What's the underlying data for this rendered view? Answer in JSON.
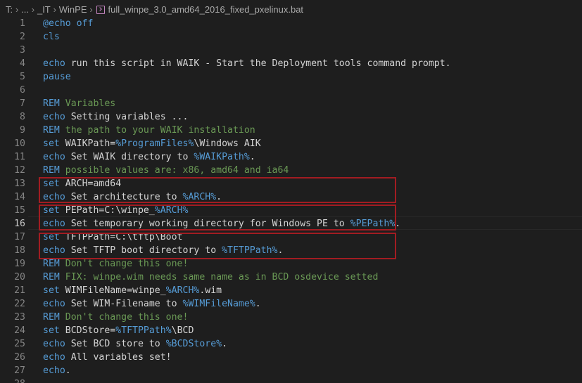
{
  "breadcrumb": {
    "items": [
      "T:",
      "...",
      "_IT",
      "WinPE"
    ],
    "file_icon": "batch-file-icon",
    "file_name": "full_winpe_3.0_amd64_2016_fixed_pxelinux.bat"
  },
  "colors": {
    "background": "#1e1e1e",
    "keyword": "#569cd6",
    "comment": "#6a9955",
    "text": "#d4d4d4",
    "line_number": "#858585",
    "highlight_box": "#a21c22"
  },
  "editor": {
    "active_line": 16,
    "highlighted_ranges": [
      [
        13,
        14
      ],
      [
        15,
        16
      ],
      [
        17,
        18
      ]
    ],
    "lines": [
      {
        "n": "1",
        "tokens": [
          {
            "t": "kw",
            "v": "@echo off"
          }
        ]
      },
      {
        "n": "2",
        "tokens": [
          {
            "t": "kw",
            "v": "cls"
          }
        ]
      },
      {
        "n": "3",
        "tokens": []
      },
      {
        "n": "4",
        "tokens": [
          {
            "t": "kw",
            "v": "echo"
          },
          {
            "t": "txt",
            "v": " run this script in WAIK - Start the Deployment tools command prompt."
          }
        ]
      },
      {
        "n": "5",
        "tokens": [
          {
            "t": "kw",
            "v": "pause"
          }
        ]
      },
      {
        "n": "6",
        "tokens": []
      },
      {
        "n": "7",
        "tokens": [
          {
            "t": "kw",
            "v": "REM"
          },
          {
            "t": "cmt",
            "v": " Variables"
          }
        ]
      },
      {
        "n": "8",
        "tokens": [
          {
            "t": "kw",
            "v": "echo"
          },
          {
            "t": "txt",
            "v": " Setting variables ..."
          }
        ]
      },
      {
        "n": "9",
        "tokens": [
          {
            "t": "kw",
            "v": "REM"
          },
          {
            "t": "cmt",
            "v": " the path to your WAIK installation"
          }
        ]
      },
      {
        "n": "10",
        "tokens": [
          {
            "t": "kw",
            "v": "set"
          },
          {
            "t": "txt",
            "v": " WAIKPath="
          },
          {
            "t": "var",
            "v": "%ProgramFiles%"
          },
          {
            "t": "txt",
            "v": "\\Windows AIK"
          }
        ]
      },
      {
        "n": "11",
        "tokens": [
          {
            "t": "kw",
            "v": "echo"
          },
          {
            "t": "txt",
            "v": " Set WAIK directory to "
          },
          {
            "t": "var",
            "v": "%WAIKPath%"
          },
          {
            "t": "txt",
            "v": "."
          }
        ]
      },
      {
        "n": "12",
        "tokens": [
          {
            "t": "kw",
            "v": "REM"
          },
          {
            "t": "cmt",
            "v": " possible values are: x86, amd64 and ia64"
          }
        ]
      },
      {
        "n": "13",
        "tokens": [
          {
            "t": "kw",
            "v": "set"
          },
          {
            "t": "txt",
            "v": " ARCH=amd64"
          }
        ]
      },
      {
        "n": "14",
        "tokens": [
          {
            "t": "kw",
            "v": "echo"
          },
          {
            "t": "txt",
            "v": " Set architecture to "
          },
          {
            "t": "var",
            "v": "%ARCH%"
          },
          {
            "t": "txt",
            "v": "."
          }
        ]
      },
      {
        "n": "15",
        "tokens": [
          {
            "t": "kw",
            "v": "set"
          },
          {
            "t": "txt",
            "v": " PEPath=C:\\winpe_"
          },
          {
            "t": "var",
            "v": "%ARCH%"
          }
        ]
      },
      {
        "n": "16",
        "tokens": [
          {
            "t": "kw",
            "v": "echo"
          },
          {
            "t": "txt",
            "v": " Set temporary working directory for Windows PE to "
          },
          {
            "t": "var",
            "v": "%PEPath%"
          },
          {
            "t": "txt",
            "v": "."
          }
        ]
      },
      {
        "n": "17",
        "tokens": [
          {
            "t": "kw",
            "v": "set"
          },
          {
            "t": "txt",
            "v": " TFTPPath=C:\\tftp\\Boot"
          }
        ]
      },
      {
        "n": "18",
        "tokens": [
          {
            "t": "kw",
            "v": "echo"
          },
          {
            "t": "txt",
            "v": " Set TFTP boot directory to "
          },
          {
            "t": "var",
            "v": "%TFTPPath%"
          },
          {
            "t": "txt",
            "v": "."
          }
        ]
      },
      {
        "n": "19",
        "tokens": [
          {
            "t": "kw",
            "v": "REM"
          },
          {
            "t": "cmt",
            "v": " Don't change this one!"
          }
        ]
      },
      {
        "n": "20",
        "tokens": [
          {
            "t": "kw",
            "v": "REM"
          },
          {
            "t": "cmt",
            "v": " FIX: winpe.wim needs same name as in BCD osdevice setted"
          }
        ]
      },
      {
        "n": "21",
        "tokens": [
          {
            "t": "kw",
            "v": "set"
          },
          {
            "t": "txt",
            "v": " WIMFileName=winpe_"
          },
          {
            "t": "var",
            "v": "%ARCH%"
          },
          {
            "t": "txt",
            "v": ".wim"
          }
        ]
      },
      {
        "n": "22",
        "tokens": [
          {
            "t": "kw",
            "v": "echo"
          },
          {
            "t": "txt",
            "v": " Set WIM-Filename to "
          },
          {
            "t": "var",
            "v": "%WIMFileName%"
          },
          {
            "t": "txt",
            "v": "."
          }
        ]
      },
      {
        "n": "23",
        "tokens": [
          {
            "t": "kw",
            "v": "REM"
          },
          {
            "t": "cmt",
            "v": " Don't change this one!"
          }
        ]
      },
      {
        "n": "24",
        "tokens": [
          {
            "t": "kw",
            "v": "set"
          },
          {
            "t": "txt",
            "v": " BCDStore="
          },
          {
            "t": "var",
            "v": "%TFTPPath%"
          },
          {
            "t": "txt",
            "v": "\\BCD"
          }
        ]
      },
      {
        "n": "25",
        "tokens": [
          {
            "t": "kw",
            "v": "echo"
          },
          {
            "t": "txt",
            "v": " Set BCD store to "
          },
          {
            "t": "var",
            "v": "%BCDStore%"
          },
          {
            "t": "txt",
            "v": "."
          }
        ]
      },
      {
        "n": "26",
        "tokens": [
          {
            "t": "kw",
            "v": "echo"
          },
          {
            "t": "txt",
            "v": " All variables set!"
          }
        ]
      },
      {
        "n": "27",
        "tokens": [
          {
            "t": "kw",
            "v": "echo"
          },
          {
            "t": "txt",
            "v": "."
          }
        ]
      },
      {
        "n": "28",
        "tokens": []
      }
    ]
  }
}
